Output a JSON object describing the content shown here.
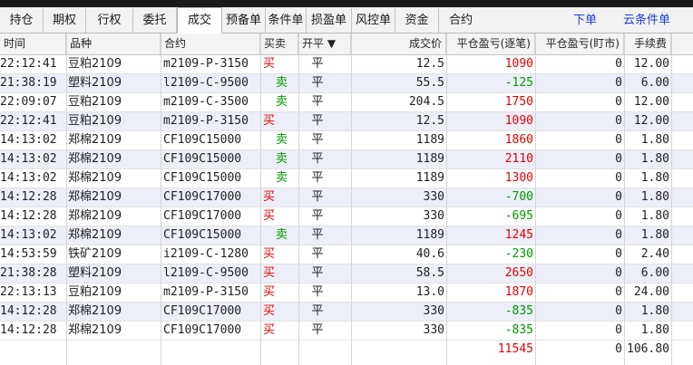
{
  "tabs": [
    {
      "label": "持仓"
    },
    {
      "label": "期权"
    },
    {
      "label": "行权"
    },
    {
      "label": "委托"
    },
    {
      "label": "成交"
    },
    {
      "label": "预备单"
    },
    {
      "label": "条件单"
    },
    {
      "label": "损盈单"
    },
    {
      "label": "风控单"
    },
    {
      "label": "资金"
    },
    {
      "label": "合约"
    }
  ],
  "links": {
    "order": "下单",
    "cloud_cond": "云条件单"
  },
  "columns": {
    "time": "时间",
    "product": "品种",
    "contract": "合约",
    "direction": "买卖",
    "offset": "开平 ▼",
    "price": "成交价",
    "pnl_trade": "平仓盈亏(逐笔)",
    "pnl_mark": "平仓盈亏(盯市)",
    "fee": "手续费"
  },
  "colors": {
    "buy": "#e60000",
    "sell": "#009900",
    "profit": "#e60000",
    "loss": "#009900"
  },
  "trades": [
    {
      "time": "22:12:41",
      "product": "豆粕2109",
      "contract": "m2109-P-3150",
      "direction": "买",
      "dir_type": "buy",
      "offset": "平",
      "price": "12.5",
      "pnl_trade": "1090",
      "pnl_type": "profit",
      "pnl_mark": "0",
      "fee": "12.00"
    },
    {
      "time": "21:38:19",
      "product": "塑料2109",
      "contract": "l2109-C-9500",
      "direction": "卖",
      "dir_type": "sell",
      "offset": "平",
      "price": "55.5",
      "pnl_trade": "-125",
      "pnl_type": "loss",
      "pnl_mark": "0",
      "fee": "6.00"
    },
    {
      "time": "22:09:07",
      "product": "豆粕2109",
      "contract": "m2109-C-3500",
      "direction": "卖",
      "dir_type": "sell",
      "offset": "平",
      "price": "204.5",
      "pnl_trade": "1750",
      "pnl_type": "profit",
      "pnl_mark": "0",
      "fee": "12.00"
    },
    {
      "time": "22:12:41",
      "product": "豆粕2109",
      "contract": "m2109-P-3150",
      "direction": "买",
      "dir_type": "buy",
      "offset": "平",
      "price": "12.5",
      "pnl_trade": "1090",
      "pnl_type": "profit",
      "pnl_mark": "0",
      "fee": "12.00"
    },
    {
      "time": "14:13:02",
      "product": "郑棉2109",
      "contract": "CF109C15000",
      "direction": "卖",
      "dir_type": "sell",
      "offset": "平",
      "price": "1189",
      "pnl_trade": "1860",
      "pnl_type": "profit",
      "pnl_mark": "0",
      "fee": "1.80"
    },
    {
      "time": "14:13:02",
      "product": "郑棉2109",
      "contract": "CF109C15000",
      "direction": "卖",
      "dir_type": "sell",
      "offset": "平",
      "price": "1189",
      "pnl_trade": "2110",
      "pnl_type": "profit",
      "pnl_mark": "0",
      "fee": "1.80"
    },
    {
      "time": "14:13:02",
      "product": "郑棉2109",
      "contract": "CF109C15000",
      "direction": "卖",
      "dir_type": "sell",
      "offset": "平",
      "price": "1189",
      "pnl_trade": "1300",
      "pnl_type": "profit",
      "pnl_mark": "0",
      "fee": "1.80"
    },
    {
      "time": "14:12:28",
      "product": "郑棉2109",
      "contract": "CF109C17000",
      "direction": "买",
      "dir_type": "buy",
      "offset": "平",
      "price": "330",
      "pnl_trade": "-700",
      "pnl_type": "loss",
      "pnl_mark": "0",
      "fee": "1.80"
    },
    {
      "time": "14:12:28",
      "product": "郑棉2109",
      "contract": "CF109C17000",
      "direction": "买",
      "dir_type": "buy",
      "offset": "平",
      "price": "330",
      "pnl_trade": "-695",
      "pnl_type": "loss",
      "pnl_mark": "0",
      "fee": "1.80"
    },
    {
      "time": "14:13:02",
      "product": "郑棉2109",
      "contract": "CF109C15000",
      "direction": "卖",
      "dir_type": "sell",
      "offset": "平",
      "price": "1189",
      "pnl_trade": "1245",
      "pnl_type": "profit",
      "pnl_mark": "0",
      "fee": "1.80"
    },
    {
      "time": "14:53:59",
      "product": "铁矿2109",
      "contract": "i2109-C-1280",
      "direction": "买",
      "dir_type": "buy",
      "offset": "平",
      "price": "40.6",
      "pnl_trade": "-230",
      "pnl_type": "loss",
      "pnl_mark": "0",
      "fee": "2.40"
    },
    {
      "time": "21:38:28",
      "product": "塑料2109",
      "contract": "l2109-C-9500",
      "direction": "买",
      "dir_type": "buy",
      "offset": "平",
      "price": "58.5",
      "pnl_trade": "2650",
      "pnl_type": "profit",
      "pnl_mark": "0",
      "fee": "6.00"
    },
    {
      "time": "22:13:13",
      "product": "豆粕2109",
      "contract": "m2109-P-3150",
      "direction": "买",
      "dir_type": "buy",
      "offset": "平",
      "price": "13.0",
      "pnl_trade": "1870",
      "pnl_type": "profit",
      "pnl_mark": "0",
      "fee": "24.00"
    },
    {
      "time": "14:12:28",
      "product": "郑棉2109",
      "contract": "CF109C17000",
      "direction": "买",
      "dir_type": "buy",
      "offset": "平",
      "price": "330",
      "pnl_trade": "-835",
      "pnl_type": "loss",
      "pnl_mark": "0",
      "fee": "1.80"
    },
    {
      "time": "14:12:28",
      "product": "郑棉2109",
      "contract": "CF109C17000",
      "direction": "买",
      "dir_type": "buy",
      "offset": "平",
      "price": "330",
      "pnl_trade": "-835",
      "pnl_type": "loss",
      "pnl_mark": "0",
      "fee": "1.80"
    }
  ],
  "totals": {
    "pnl_trade": "11545",
    "pnl_mark": "0",
    "fee": "106.80"
  }
}
